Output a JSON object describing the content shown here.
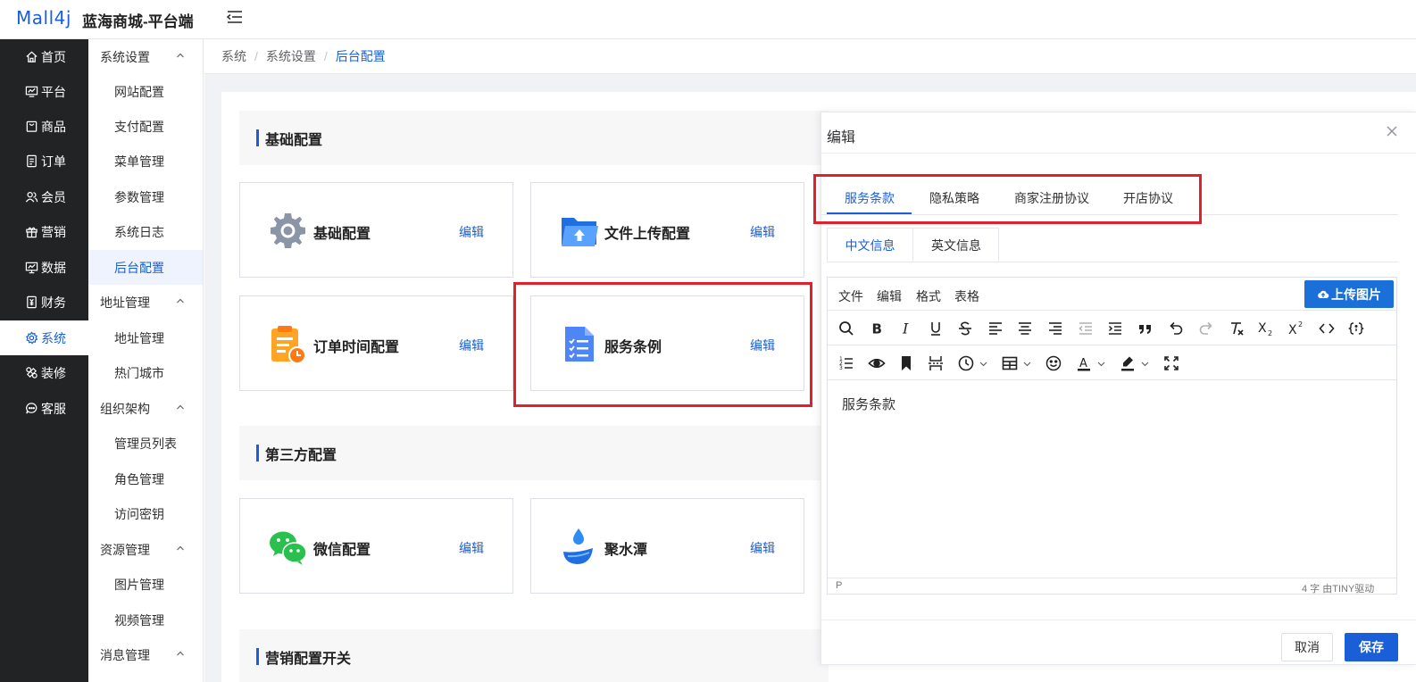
{
  "header": {
    "logo": "Mall4j",
    "app_name": "蓝海商城-平台端"
  },
  "nav": [
    {
      "label": "首页",
      "icon": "home-icon"
    },
    {
      "label": "平台",
      "icon": "monitor-icon"
    },
    {
      "label": "商品",
      "icon": "bag-icon"
    },
    {
      "label": "订单",
      "icon": "document-icon"
    },
    {
      "label": "会员",
      "icon": "users-icon"
    },
    {
      "label": "营销",
      "icon": "gift-icon"
    },
    {
      "label": "数据",
      "icon": "chart-icon"
    },
    {
      "label": "财务",
      "icon": "finance-icon"
    },
    {
      "label": "系统",
      "icon": "gear-icon"
    },
    {
      "label": "装修",
      "icon": "brush-icon"
    },
    {
      "label": "客服",
      "icon": "chat-icon"
    }
  ],
  "subnav": {
    "group_system": "系统设置",
    "items_system": [
      "网站配置",
      "支付配置",
      "菜单管理",
      "参数管理",
      "系统日志",
      "后台配置"
    ],
    "group_address": "地址管理",
    "items_address": [
      "地址管理",
      "热门城市"
    ],
    "group_org": "组织架构",
    "items_org": [
      "管理员列表",
      "角色管理",
      "访问密钥"
    ],
    "group_resource": "资源管理",
    "items_resource": [
      "图片管理",
      "视频管理"
    ],
    "group_message": "消息管理"
  },
  "breadcrumb": [
    "系统",
    "系统设置",
    "后台配置"
  ],
  "sections": {
    "basic": "基础配置",
    "third_party": "第三方配置",
    "marketing": "营销配置开关"
  },
  "cards": [
    {
      "title": "基础配置",
      "edit": "编辑",
      "icon": "gear-icon"
    },
    {
      "title": "文件上传配置",
      "edit": "编辑",
      "icon": "upload-folder-icon"
    },
    {
      "title": "订单时间配置",
      "edit": "编辑",
      "icon": "clipboard-clock-icon"
    },
    {
      "title": "服务条例",
      "edit": "编辑",
      "icon": "document-list-icon"
    },
    {
      "title": "微信配置",
      "edit": "编辑",
      "icon": "wechat-icon"
    },
    {
      "title": "聚水潭",
      "edit": "编辑",
      "icon": "water-drop-icon"
    }
  ],
  "drawer": {
    "title": "编辑",
    "tabs": [
      "服务条款",
      "隐私策略",
      "商家注册协议",
      "开店协议"
    ],
    "lang_tabs": [
      "中文信息",
      "英文信息"
    ],
    "editor": {
      "menu": [
        "文件",
        "编辑",
        "格式",
        "表格"
      ],
      "upload_label": "上传图片",
      "content": "服务条款",
      "status_path": "P",
      "status_words": "4 字  由TINY驱动"
    },
    "cancel": "取消",
    "save": "保存"
  },
  "colors": {
    "accent": "#1a5fd8",
    "highlight_box": "#e0202b",
    "sidebar": "#222325"
  }
}
